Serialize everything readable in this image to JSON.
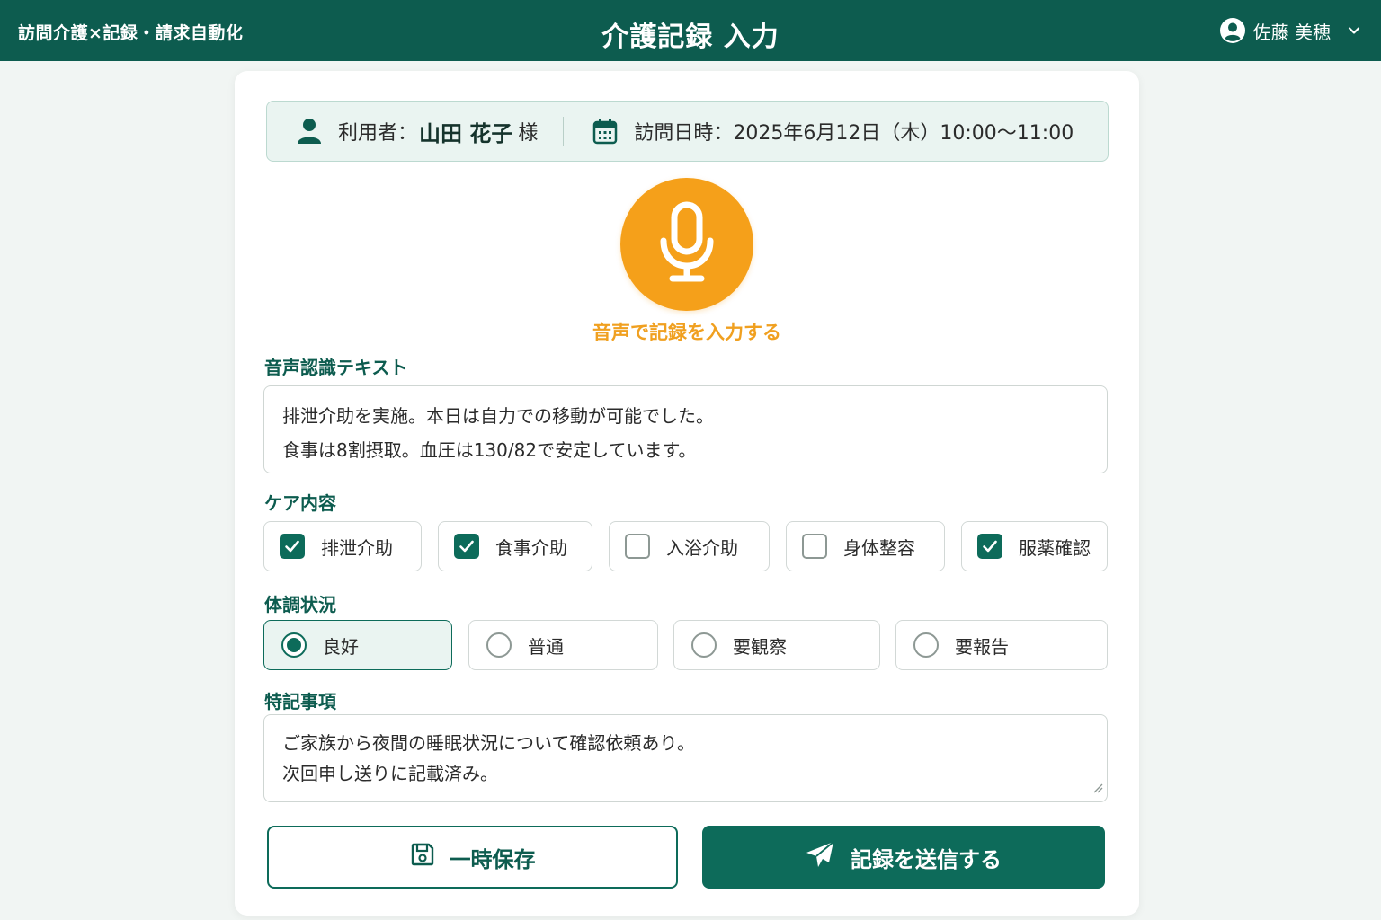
{
  "header": {
    "brand": "訪問介護×記録・請求自動化",
    "title": "介護記録 入力",
    "user_name": "佐藤 美穂"
  },
  "visit": {
    "user_label": "利用者：",
    "user_name": "山田 花子",
    "honorific": "様",
    "datetime_label": "訪問日時：",
    "datetime": "2025年6月12日（木）10:00〜11:00"
  },
  "voice": {
    "button_label": "音声で記録を入力する"
  },
  "transcript": {
    "label": "音声認識テキスト",
    "lines": [
      "排泄介助を実施。本日は自力での移動が可能でした。",
      "食事は8割摂取。血圧は130/82で安定しています。"
    ]
  },
  "care": {
    "label": "ケア内容",
    "items": [
      {
        "label": "排泄介助",
        "checked": true
      },
      {
        "label": "食事介助",
        "checked": true
      },
      {
        "label": "入浴介助",
        "checked": false
      },
      {
        "label": "身体整容",
        "checked": false
      },
      {
        "label": "服薬確認",
        "checked": true
      }
    ]
  },
  "condition": {
    "label": "体調状況",
    "options": [
      {
        "label": "良好",
        "selected": true
      },
      {
        "label": "普通",
        "selected": false
      },
      {
        "label": "要観察",
        "selected": false
      },
      {
        "label": "要報告",
        "selected": false
      }
    ]
  },
  "notes": {
    "label": "特記事項",
    "lines": [
      "ご家族から夜間の睡眠状況について確認依頼あり。",
      "次回申し送りに記載済み。"
    ]
  },
  "actions": {
    "save_label": "一時保存",
    "submit_label": "記録を送信する"
  },
  "colors": {
    "primary": "#0d5c4f",
    "accent": "#f5a01a",
    "background": "#f1f5f3"
  },
  "icons": {
    "user": "user-circle-icon",
    "dropdown": "chevron-down-icon",
    "person": "person-icon",
    "calendar": "calendar-icon",
    "mic": "microphone-icon",
    "save": "floppy-disk-icon",
    "send": "paper-plane-icon"
  }
}
